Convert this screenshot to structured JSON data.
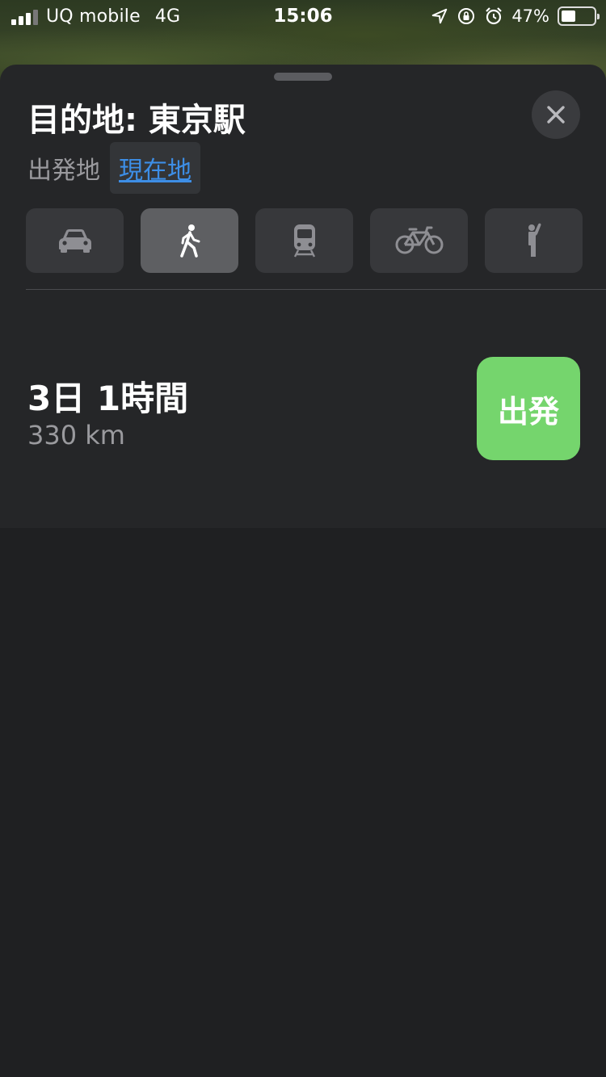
{
  "status": {
    "carrier": "UQ mobile",
    "network": "4G",
    "time": "15:06",
    "battery": "47%",
    "battery_level": 0.47
  },
  "sheet": {
    "title": "目的地: 東京駅",
    "from_label": "出発地",
    "from_value": "現在地"
  },
  "modes": [
    {
      "name": "car",
      "icon": "car-icon",
      "active": false
    },
    {
      "name": "walk",
      "icon": "walking-icon",
      "active": true
    },
    {
      "name": "transit",
      "icon": "train-icon",
      "active": false
    },
    {
      "name": "bike",
      "icon": "bicycle-icon",
      "active": false
    },
    {
      "name": "rideshare",
      "icon": "hail-icon",
      "active": false
    }
  ],
  "route": {
    "duration": "3日 1時間",
    "distance": "330 km",
    "go_label": "出発"
  },
  "colors": {
    "accent_link": "#3d8ee6",
    "go_button": "#75d56d"
  }
}
